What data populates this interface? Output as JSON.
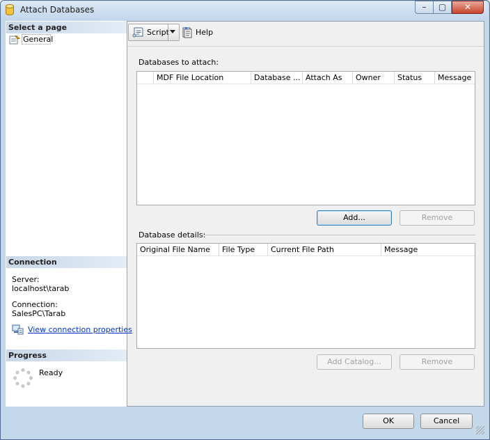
{
  "window": {
    "title": "Attach Databases",
    "controls": {
      "minimize": "–",
      "maximize": "▢",
      "close": "✕"
    }
  },
  "left": {
    "select_page_header": "Select a page",
    "pages": [
      {
        "label": "General",
        "icon": "page-properties-icon"
      }
    ],
    "connection_header": "Connection",
    "server_label": "Server:",
    "server_value": "localhost\\tarab",
    "connection_label": "Connection:",
    "connection_value": "SalesPC\\Tarab",
    "view_connection_link": "View connection properties",
    "progress_header": "Progress",
    "progress_status": "Ready"
  },
  "toolbar": {
    "script_label": "Script",
    "help_label": "Help"
  },
  "attach": {
    "section_label": "Databases to attach:",
    "columns": [
      "MDF File Location",
      "Database ...",
      "Attach As",
      "Owner",
      "Status",
      "Message"
    ],
    "add_label": "Add...",
    "remove_label": "Remove"
  },
  "details": {
    "section_label": "Database details:",
    "columns": [
      "Original File Name",
      "File Type",
      "Current File Path",
      "Message"
    ],
    "add_catalog_label": "Add Catalog...",
    "remove_label": "Remove"
  },
  "footer": {
    "ok_label": "OK",
    "cancel_label": "Cancel"
  }
}
